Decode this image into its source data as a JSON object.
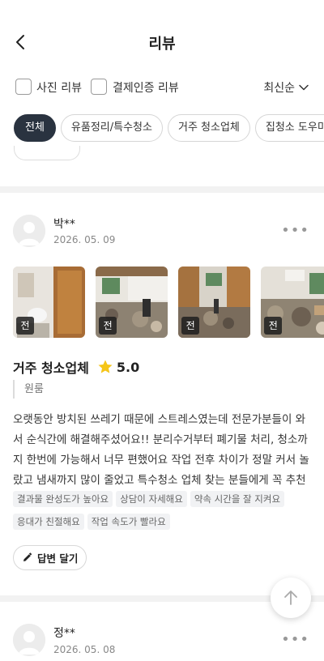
{
  "header": {
    "title": "리뷰",
    "back_icon": "chevron-left-icon"
  },
  "filters": {
    "photo_review_label": "사진 리뷰",
    "verified_review_label": "결제인증 리뷰",
    "sort_label": "최신순"
  },
  "categories": [
    "전체",
    "유품정리/특수청소",
    "거주 청소업체",
    "집청소 도우미"
  ],
  "reviews": [
    {
      "name": "박**",
      "date": "2026. 05. 09",
      "photo_badges": [
        "전",
        "전",
        "전",
        "전"
      ],
      "service": "거주 청소업체",
      "rating": "5.0",
      "option": "원룸",
      "text": "오랫동안 방치된 쓰레기 때문에 스트레스였는데 전문가분들이 와서 순식간에 해결해주셨어요!! 분리수거부터 폐기물 처리, 청소까지 한번에 가능해서 너무 편했어요 작업 전후 차이가 정말 커서 놀랐고 냄새까지 많이 줄었고 특수청소 업체 찾는 분들에게 꼭 추천드려용",
      "keywords": [
        "결과물 완성도가 높아요",
        "상담이 자세해요",
        "약속 시간을 잘 지켜요",
        "응대가 친절해요",
        "작업 속도가 빨라요"
      ],
      "reply_label": "답변 달기"
    },
    {
      "name": "정**",
      "date": "2026. 05. 08"
    }
  ],
  "colors": {
    "active_chip": "#2a3340",
    "star": "#f5c518",
    "divider": "#f2f2f2"
  }
}
